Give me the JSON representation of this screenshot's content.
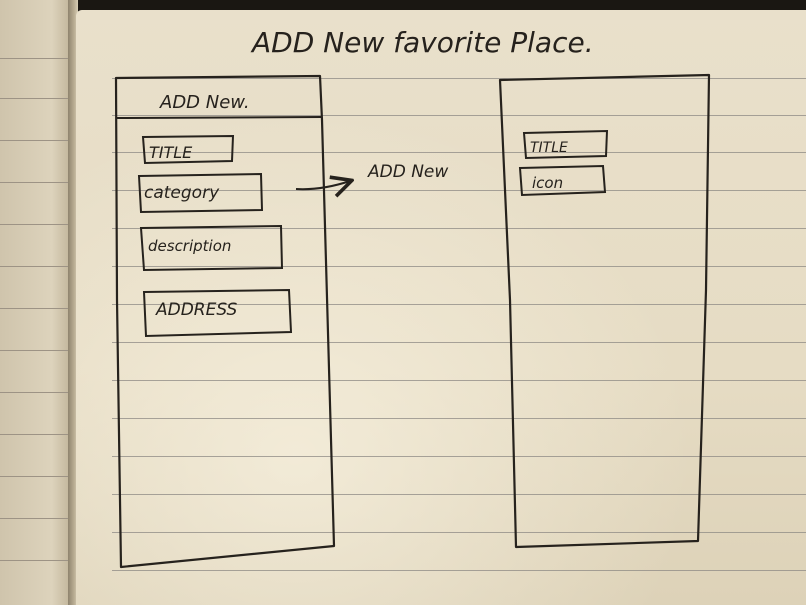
{
  "title": "ADD New favorite Place.",
  "left_screen": {
    "header": "ADD New.",
    "fields": [
      "TITLE",
      "category",
      "description",
      "ADDRESS"
    ]
  },
  "arrow_label": "ADD New",
  "right_screen": {
    "fields": [
      "TITLE",
      "icon"
    ]
  },
  "colors": {
    "ink": "#26221d",
    "paper": "#e8dfc9"
  }
}
